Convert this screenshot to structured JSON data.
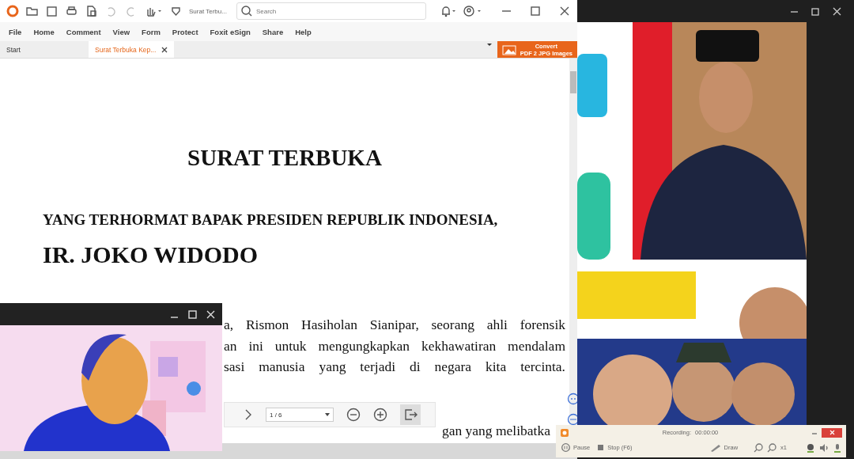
{
  "foxit": {
    "doc_title": "Surat Terbu...",
    "search": {
      "placeholder": "Search"
    },
    "menu": [
      "File",
      "Home",
      "Comment",
      "View",
      "Form",
      "Protect",
      "Foxit eSign",
      "Share",
      "Help"
    ],
    "tabs": [
      {
        "label": "Start",
        "selected": false
      },
      {
        "label": "Surat Terbuka Kep...",
        "selected": true
      }
    ],
    "convert_button": {
      "line_1": "Convert",
      "line_2": "PDF 2 JPG Images"
    },
    "document": {
      "title": "SURAT TERBUKA",
      "addressee": "YANG TERHORMAT BAPAK PRESIDEN REPUBLIK INDONESIA,",
      "name": "IR. JOKO WIDODO",
      "lines": [
        "a, Rismon Hasiholan Sianipar, seorang ahli forensik",
        "an ini untuk mengungkapkan kekhawatiran mendalam",
        "sasi manusia yang terjadi di negara kita tercinta."
      ],
      "last_line": "gan yang melibatka"
    },
    "page_nav": {
      "page": "1 / 6"
    }
  },
  "recorder": {
    "title": "Recording:",
    "time": "00:00:00",
    "pause": "Pause",
    "stop": "Stop (F6)",
    "draw": "Draw",
    "zoom": "x1"
  }
}
